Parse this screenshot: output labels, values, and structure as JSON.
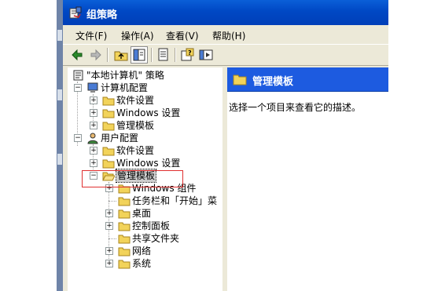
{
  "window": {
    "title": "组策略",
    "menu": [
      "文件(F)",
      "操作(A)",
      "查看(V)",
      "帮助(H)"
    ]
  },
  "toolbar": {
    "buttons": [
      "back-arrow-icon",
      "forward-arrow-icon",
      "up-folder-icon",
      "show-tree-icon",
      "export-list-icon",
      "help-icon",
      "properties-icon"
    ]
  },
  "tree": {
    "root": "\"本地计算机\" 策略",
    "computer": {
      "label": "计算机配置",
      "children": [
        "软件设置",
        "Windows 设置",
        "管理模板"
      ]
    },
    "user": {
      "label": "用户配置",
      "children": [
        "软件设置",
        "Windows 设置",
        "管理模板"
      ],
      "admin_children": [
        "Windows 组件",
        "任务栏和「开始」菜",
        "桌面",
        "控制面板",
        "共享文件夹",
        "网络",
        "系统"
      ]
    }
  },
  "detail": {
    "header": "管理模板",
    "description": "选择一个项目来查看它的描述。"
  },
  "colors": {
    "titlebar": "#0048c4",
    "detail_header": "#1d5be0",
    "highlight_box": "#e03030"
  }
}
